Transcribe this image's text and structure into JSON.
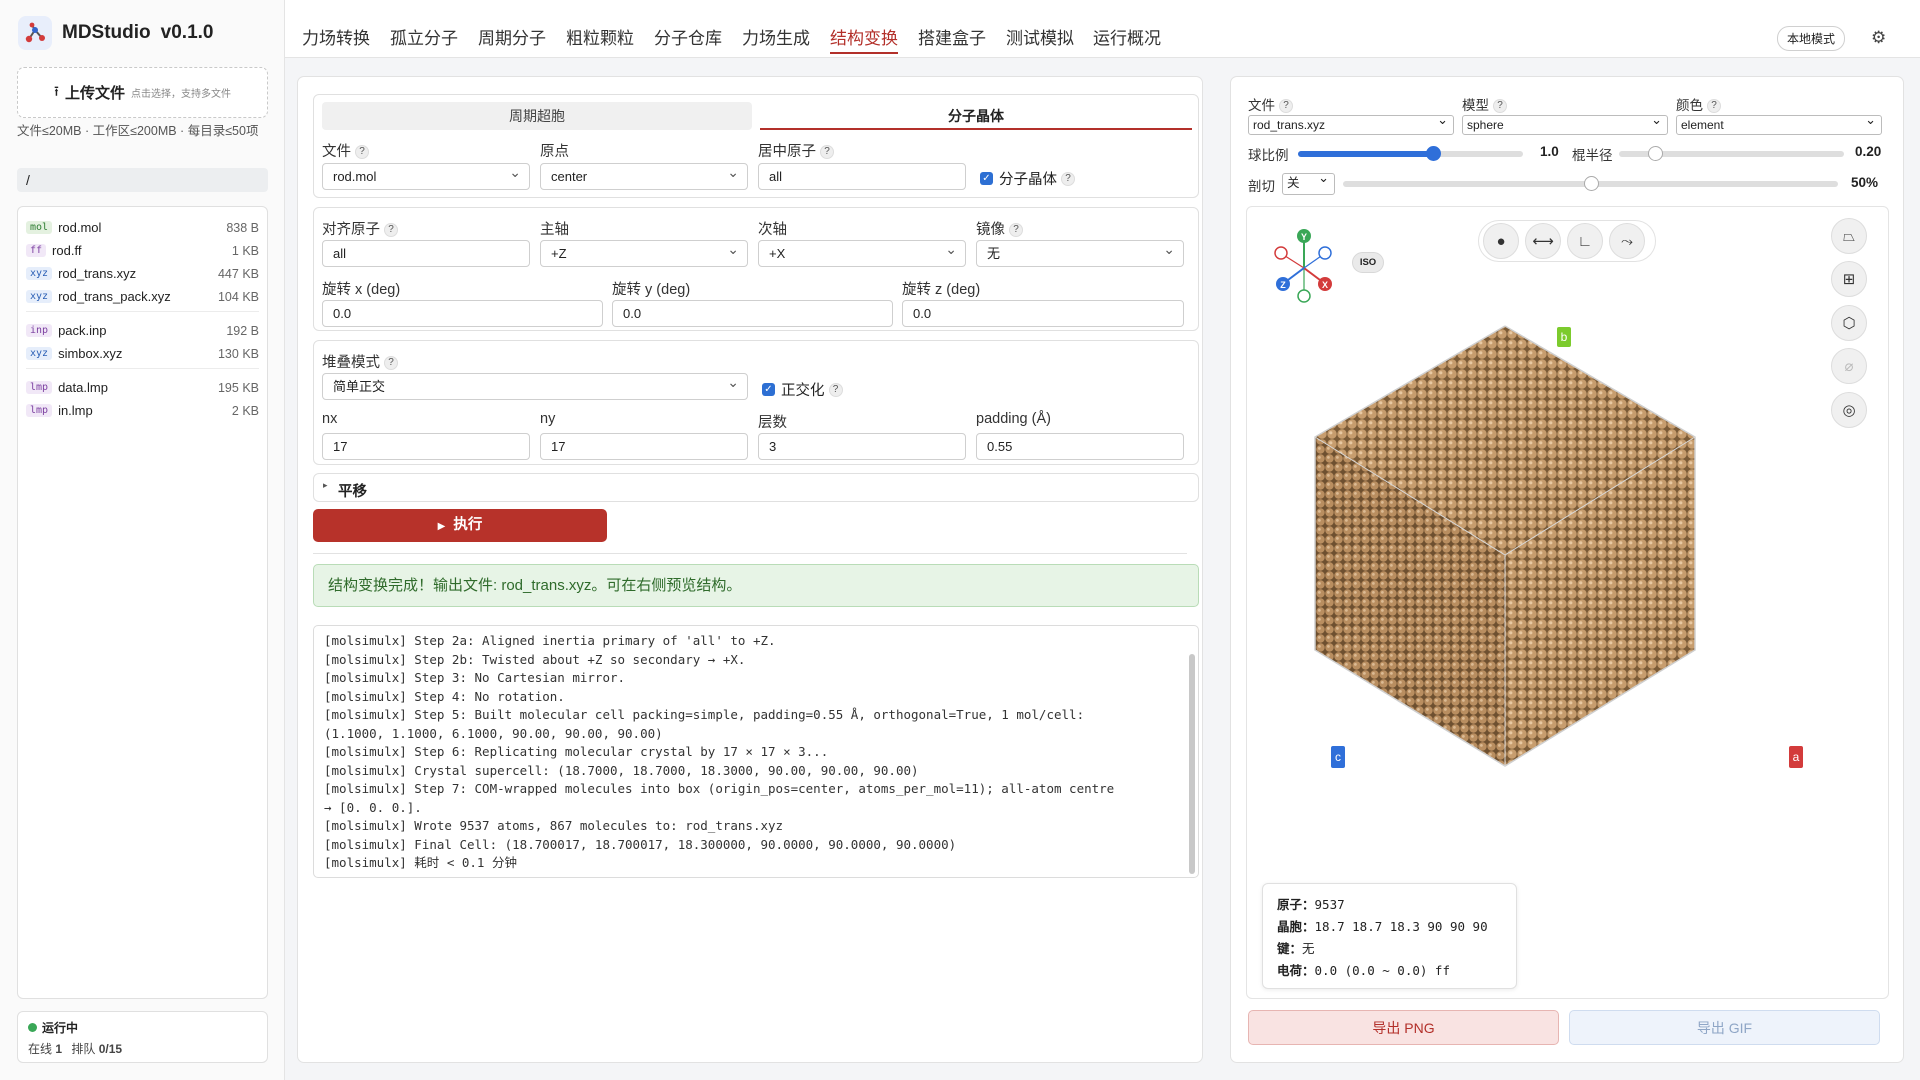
{
  "app": {
    "name": "MDStudio",
    "version": "v0.1.0"
  },
  "sidebar": {
    "upload_label": "上传文件",
    "upload_hint": "点击选择，支持多文件",
    "limits": "文件≤20MB · 工作区≤200MB · 每目录≤50项",
    "path": "/",
    "groups": [
      [
        {
          "ext": "mol",
          "name": "rod.mol",
          "size": "838 B",
          "color": "#e4f1e0",
          "fg": "#2e7d32"
        },
        {
          "ext": "ff",
          "name": "rod.ff",
          "size": "1 KB",
          "color": "#f1e8f7",
          "fg": "#7b3fa0"
        },
        {
          "ext": "xyz",
          "name": "rod_trans.xyz",
          "size": "447 KB",
          "color": "#e6eefb",
          "fg": "#2a5fb5"
        },
        {
          "ext": "xyz",
          "name": "rod_trans_pack.xyz",
          "size": "104 KB",
          "color": "#e6eefb",
          "fg": "#2a5fb5"
        }
      ],
      [
        {
          "ext": "inp",
          "name": "pack.inp",
          "size": "192 B",
          "color": "#f1e8f7",
          "fg": "#7b3fa0"
        },
        {
          "ext": "xyz",
          "name": "simbox.xyz",
          "size": "130 KB",
          "color": "#e6eefb",
          "fg": "#2a5fb5"
        }
      ],
      [
        {
          "ext": "lmp",
          "name": "data.lmp",
          "size": "195 KB",
          "color": "#f1e8f7",
          "fg": "#7b3fa0"
        },
        {
          "ext": "lmp",
          "name": "in.lmp",
          "size": "2 KB",
          "color": "#f1e8f7",
          "fg": "#7b3fa0"
        }
      ]
    ],
    "status": {
      "label": "运行中",
      "online_label": "在线",
      "online": "1",
      "queue_label": "排队",
      "queue": "0/15"
    }
  },
  "nav": {
    "tabs": [
      "力场转换",
      "孤立分子",
      "周期分子",
      "粗粒颗粒",
      "分子仓库",
      "力场生成",
      "结构变换",
      "搭建盒子",
      "测试模拟",
      "运行概况"
    ],
    "active_index": 6,
    "local_mode": "本地模式"
  },
  "form": {
    "segments": [
      "周期超胞",
      "分子晶体"
    ],
    "active_segment": 1,
    "file": {
      "label": "文件",
      "value": "rod.mol"
    },
    "origin": {
      "label": "原点",
      "value": "center"
    },
    "center_atom": {
      "label": "居中原子",
      "value": "all"
    },
    "molecular_crystal": {
      "label": "分子晶体",
      "checked": true
    },
    "align_atoms": {
      "label": "对齐原子",
      "value": "all"
    },
    "primary_axis": {
      "label": "主轴",
      "value": "+Z"
    },
    "secondary_axis": {
      "label": "次轴",
      "value": "+X"
    },
    "mirror": {
      "label": "镜像",
      "value": "无"
    },
    "rot_x": {
      "label": "旋转 x (deg)",
      "value": "0.0"
    },
    "rot_y": {
      "label": "旋转 y (deg)",
      "value": "0.0"
    },
    "rot_z": {
      "label": "旋转 z (deg)",
      "value": "0.0"
    },
    "stack_mode": {
      "label": "堆叠模式",
      "value": "简单正交"
    },
    "orthogonal": {
      "label": "正交化",
      "checked": true
    },
    "nx": {
      "label": "nx",
      "value": "17"
    },
    "ny": {
      "label": "ny",
      "value": "17"
    },
    "layers": {
      "label": "层数",
      "value": "3"
    },
    "padding": {
      "label": "padding (Å)",
      "value": "0.55"
    },
    "translate_label": "平移",
    "run_label": "执行",
    "success_msg": "结构变换完成！输出文件: rod_trans.xyz。可在右侧预览结构。"
  },
  "log": [
    "[molsimulx] Step 2a: Aligned inertia primary of 'all' to +Z.",
    "[molsimulx] Step 2b: Twisted about +Z so secondary → +X.",
    "[molsimulx] Step 3: No Cartesian mirror.",
    "[molsimulx] Step 4: No rotation.",
    "[molsimulx] Step 5: Built molecular cell packing=simple, padding=0.55 Å, orthogonal=True, 1 mol/cell:",
    "(1.1000, 1.1000, 6.1000, 90.00, 90.00, 90.00)",
    "[molsimulx] Step 6: Replicating molecular crystal by 17 × 17 × 3...",
    "[molsimulx] Crystal supercell: (18.7000, 18.7000, 18.3000, 90.00, 90.00, 90.00)",
    "[molsimulx] Step 7: COM-wrapped molecules into box (origin_pos=center, atoms_per_mol=11); all-atom centre",
    "→ [0. 0. 0.].",
    "[molsimulx] Wrote 9537 atoms, 867 molecules to: rod_trans.xyz",
    "[molsimulx] Final Cell: (18.700017, 18.700017, 18.300000, 90.0000, 90.0000, 90.0000)",
    "[molsimulx] 耗时 < 0.1 分钟"
  ],
  "viewer": {
    "file": {
      "label": "文件",
      "value": "rod_trans.xyz"
    },
    "model": {
      "label": "模型",
      "value": "sphere"
    },
    "color": {
      "label": "颜色",
      "value": "element"
    },
    "sphere_scale": {
      "label": "球比例",
      "value": "1.0",
      "level": 0.6
    },
    "stick_radius": {
      "label": "棍半径",
      "value": "0.20",
      "level": 0.16
    },
    "clip": {
      "label": "剖切",
      "mode": "关",
      "value": "50%",
      "level": 0.5
    },
    "iso_label": "ISO",
    "axis_labels": {
      "a": "a",
      "b": "b",
      "c": "c"
    },
    "gizmo": {
      "x": "X",
      "y": "Y",
      "z": "Z"
    },
    "atom_color": "#c79d6e",
    "info": {
      "atoms_label": "原子：",
      "atoms": "9537",
      "cell_label": "晶胞：",
      "cell": "18.7 18.7 18.3 90 90 90",
      "bonds_label": "键：",
      "bonds": "无",
      "charge_label": "电荷：",
      "charge": "0.0 (0.0 ~ 0.0) ff"
    },
    "export_png": "导出 PNG",
    "export_gif": "导出 GIF"
  }
}
